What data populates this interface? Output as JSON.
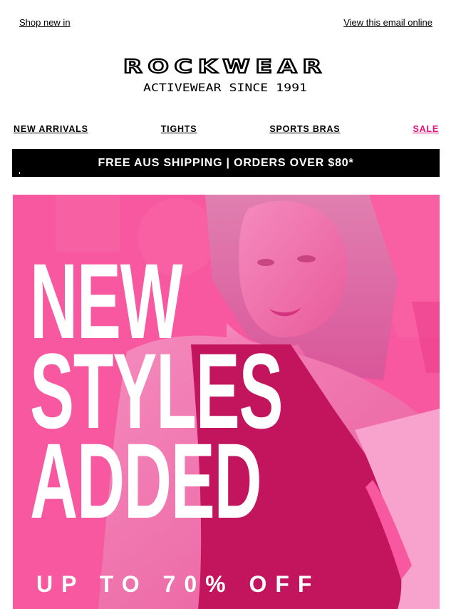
{
  "top_links": {
    "shop_new_in": "Shop new in",
    "view_online": "View this email online"
  },
  "brand": {
    "name": "ROCKWEAR",
    "tagline": "ACTIVEWEAR SINCE 1991"
  },
  "nav": {
    "items": [
      {
        "label": "NEW ARRIVALS"
      },
      {
        "label": "TIGHTS"
      },
      {
        "label": "SPORTS BRAS"
      },
      {
        "label": "SALE"
      }
    ]
  },
  "shipping_banner": {
    "text": "FREE AUS SHIPPING | ORDERS OVER $80*"
  },
  "hero": {
    "title_lines": [
      "NEW",
      "STYLES",
      "ADDED"
    ],
    "subtitle": "UP TO 70% OFF"
  },
  "colors": {
    "accent_pink": "#e2137c",
    "hero_pink": "#f7589f",
    "banner_black": "#000000"
  }
}
